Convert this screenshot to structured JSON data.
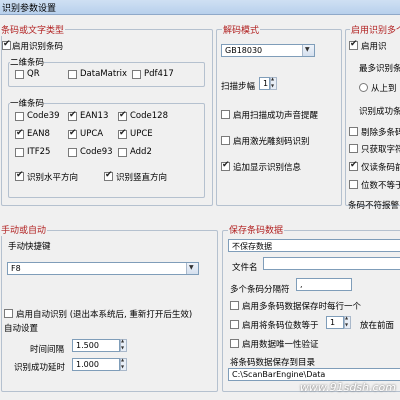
{
  "window": {
    "title": "识别参数设置"
  },
  "group_type": {
    "title": "条码或文字类型",
    "enable_barcode": "启用识别条码",
    "twod_title": "二维条码",
    "twod_items": [
      "QR",
      "DataMatrix",
      "Pdf417"
    ],
    "oned_title": "一维条码",
    "oned_items": [
      "Code39",
      "EAN13",
      "Code128",
      "EAN8",
      "UPCA",
      "UPCE",
      "ITF25",
      "Code93",
      "Add2"
    ],
    "horizontal": "识别水平方向",
    "vertical": "识别竖直方向"
  },
  "group_decode": {
    "title": "解码模式",
    "mode_value": "GB18030",
    "scan_step_label": "扫描步幅",
    "scan_step_value": "1",
    "beep": "启用扫描成功声音提醒",
    "laser": "启用激光雕刻码识别",
    "append_info": "追加显示识别信息"
  },
  "group_multi": {
    "title": "启用识别多个",
    "enable": "启用识",
    "max_label": "最多识别条",
    "order": "从上到",
    "info_label": "识别成功条",
    "opt1": "剔除多条码",
    "opt2": "只获取字符",
    "opt3": "仅读条码前",
    "opt4": "位数不等于",
    "warn": "条码不符报警"
  },
  "group_manual": {
    "title": "手动或自动",
    "hotkey_label": "手动快捷键",
    "hotkey_value": "F8",
    "auto_enable": "启用自动识别 (退出本系统后, 重新打开后生效)",
    "auto_settings": "自动设置",
    "interval_label": "时间间隔",
    "interval_value": "1.500",
    "delay_label": "识别成功延时",
    "delay_value": "1.000"
  },
  "group_save": {
    "title": "保存条码数据",
    "mode_value": "不保存数据",
    "filename_label": "文件名",
    "separator_label": "多个条码分隔符",
    "separator_value": ",",
    "opt_multi_line": "启用多条码数据保存时每行一个",
    "opt_digits_a": "启用将条码位数等于",
    "digits_value": "1",
    "opt_digits_b": "放在前面",
    "opt_unique": "启用数据唯一性验证",
    "dir_label": "将条码数据保存到目录",
    "dir_value": "C:\\ScanBarEngine\\Data"
  },
  "watermark": "www.91sdsh.com"
}
